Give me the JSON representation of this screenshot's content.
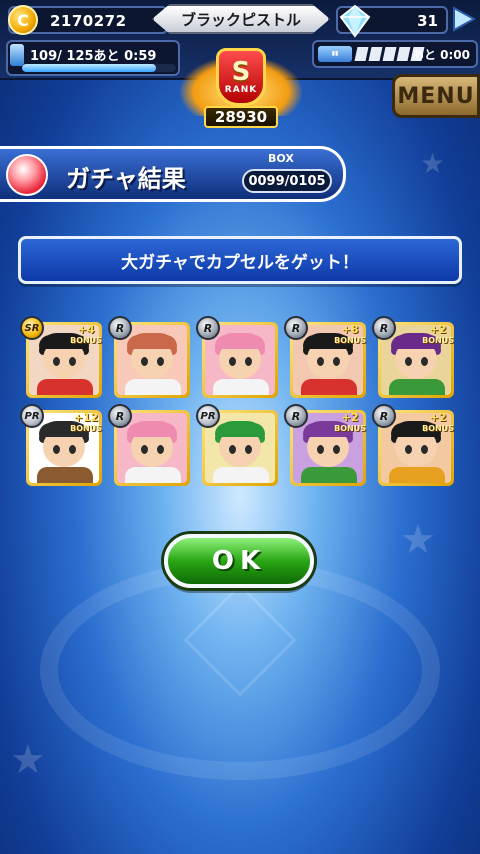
{
  "status": {
    "coins": "2170272",
    "player_name": "ブラックピストル",
    "gems": "31",
    "stamina_text": "109/ 125あと 0:59",
    "stamina_fraction": 0.872,
    "ticket_text": "あと  0:00",
    "ticket_filled": 0,
    "ticket_total": 5
  },
  "rank": {
    "letter": "S",
    "label": "RANK",
    "value": "28930"
  },
  "menu_label": "MENU",
  "header": {
    "title": "ガチャ結果",
    "box_label": "BOX",
    "box_value": "0099/0105"
  },
  "message": "大ガチャでカプセルをゲット！",
  "cards": [
    {
      "rarity": "SR",
      "bonus": "+4",
      "bonus_word": "BONUS",
      "hair": "#1a1a1a",
      "body": "#d8322e",
      "bg": "#f2d7c2"
    },
    {
      "rarity": "R",
      "bonus": "",
      "bonus_word": "",
      "hair": "#c9684a",
      "body": "#f4f4f4",
      "bg": "#f8c9b8"
    },
    {
      "rarity": "R",
      "bonus": "",
      "bonus_word": "",
      "hair": "#ef8ab0",
      "body": "#f4f4f4",
      "bg": "#f6b7c6"
    },
    {
      "rarity": "R",
      "bonus": "+8",
      "bonus_word": "BONUS",
      "hair": "#1a1a1a",
      "body": "#d8322e",
      "bg": "#f2c9b0"
    },
    {
      "rarity": "R",
      "bonus": "+2",
      "bonus_word": "BONUS",
      "hair": "#6a2a8a",
      "body": "#3a9a3a",
      "bg": "#e9d59a"
    },
    {
      "rarity": "PR",
      "bonus": "+12",
      "bonus_word": "BONUS",
      "hair": "#2a2a2a",
      "body": "#8a5a30",
      "bg": "#ffffff"
    },
    {
      "rarity": "R",
      "bonus": "",
      "bonus_word": "",
      "hair": "#ef8ab0",
      "body": "#f4f4f4",
      "bg": "#f6b7c6"
    },
    {
      "rarity": "PR",
      "bonus": "",
      "bonus_word": "",
      "hair": "#2a9a3a",
      "body": "#f4f4f4",
      "bg": "#f2e6a8"
    },
    {
      "rarity": "R",
      "bonus": "+2",
      "bonus_word": "BONUS",
      "hair": "#7a3a9a",
      "body": "#3a9a3a",
      "bg": "#c9a0e0"
    },
    {
      "rarity": "R",
      "bonus": "+2",
      "bonus_word": "BONUS",
      "hair": "#1a1a1a",
      "body": "#e8a020",
      "bg": "#f2c9a0"
    }
  ],
  "ok_label": "OK",
  "icons": {
    "coin": "coin-icon",
    "gem": "gem-icon",
    "play": "play-icon",
    "stamina": "stamina-icon",
    "ticket": "ticket-icon",
    "capsule": "capsule-icon"
  },
  "colors": {
    "accent_blue": "#2d66d6",
    "ok_green": "#2aa614",
    "gold": "#ffd84a"
  }
}
